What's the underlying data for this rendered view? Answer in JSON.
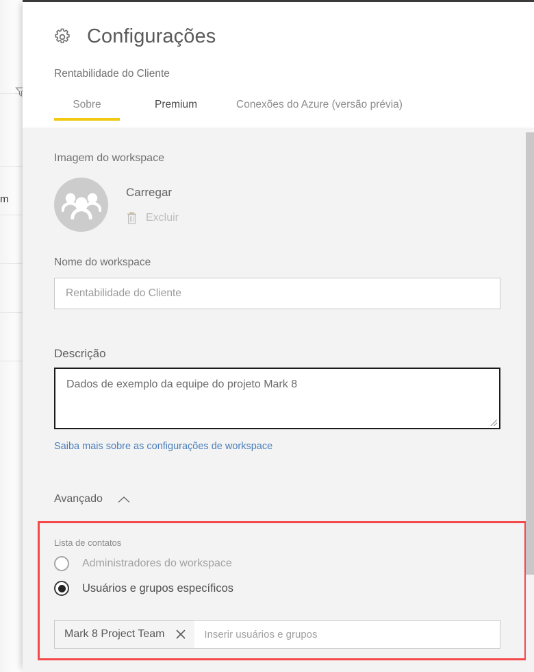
{
  "background": {
    "filter_icon": "filter-icon",
    "clipped_text": "m"
  },
  "pane": {
    "gear_icon": "gear-icon",
    "title": "Configurações",
    "subtitle": "Rentabilidade do Cliente",
    "tabs": [
      {
        "label": "Sobre",
        "active": true
      },
      {
        "label": "Premium",
        "active": false
      },
      {
        "label": "Conexões do Azure (versão prévia)",
        "active": false
      }
    ],
    "accent_color": "#f2c811"
  },
  "workspace_image": {
    "label": "Imagem do workspace",
    "avatar_icon": "workspace-group-avatar",
    "avatar_color": "#cccccc",
    "upload_label": "Carregar",
    "delete_icon": "trash-icon",
    "delete_label": "Excluir"
  },
  "workspace_name": {
    "label": "Nome do workspace",
    "value": "Rentabilidade do Cliente",
    "placeholder": "Nome do workspace"
  },
  "description": {
    "label": "Descrição",
    "value": "Dados de exemplo da equipe do projeto Mark 8",
    "placeholder": "Descrição",
    "resize_handle": "resize-grip-icon"
  },
  "learn_more": {
    "label": "Saiba mais sobre as configurações de workspace",
    "color": "#4a7ebb"
  },
  "advanced": {
    "label": "Avançado",
    "chevron_icon": "chevron-up-icon",
    "expanded": true
  },
  "highlight": {
    "color": "#f4484b"
  },
  "contact_list": {
    "label": "Lista de contatos",
    "options": [
      {
        "label": "Administradores do workspace",
        "selected": false
      },
      {
        "label": "Usuários e grupos específicos",
        "selected": true
      }
    ],
    "picker": {
      "chips": [
        {
          "label": "Mark 8 Project Team",
          "remove_icon": "close-icon"
        }
      ],
      "placeholder": "Inserir usuários e grupos",
      "value": ""
    }
  },
  "scrollbar": {
    "name": "vertical-scrollbar"
  }
}
